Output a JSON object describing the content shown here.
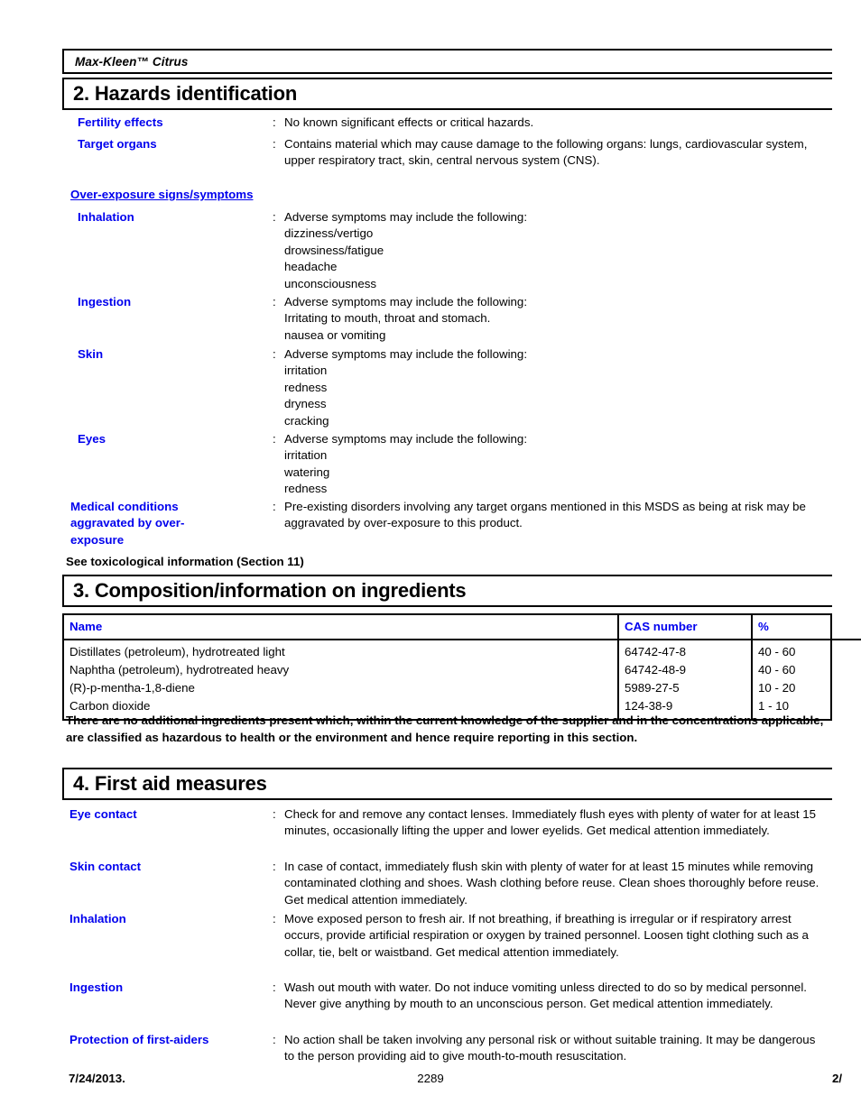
{
  "document": {
    "product_name": "Max-Kleen™ Citrus"
  },
  "section2": {
    "title": "2. Hazards identification",
    "rows": [
      {
        "label": "Fertility effects",
        "colon": ":",
        "value": "No known significant effects or critical hazards."
      },
      {
        "label": "Target organs",
        "colon": ":",
        "value": "Contains material which may cause damage to the following organs: lungs, cardiovascular system, upper respiratory tract, skin, central nervous system (CNS)."
      }
    ],
    "overexposure_heading": "Over-exposure signs/symptoms",
    "overexposure_rows": [
      {
        "label": "Inhalation",
        "colon": ":",
        "lines": [
          "Adverse symptoms may include the following:",
          "dizziness/vertigo",
          "drowsiness/fatigue",
          "headache",
          "unconsciousness"
        ]
      },
      {
        "label": "Ingestion",
        "colon": ":",
        "lines": [
          "Adverse symptoms may include the following:",
          "Irritating to mouth, throat and stomach.",
          "nausea or vomiting"
        ]
      },
      {
        "label": "Skin",
        "colon": ":",
        "lines": [
          "Adverse symptoms may include the following:",
          "irritation",
          "redness",
          "dryness",
          "cracking"
        ]
      },
      {
        "label": "Eyes",
        "colon": ":",
        "lines": [
          "Adverse symptoms may include the following:",
          "irritation",
          "watering",
          "redness"
        ]
      }
    ],
    "medical_conditions": {
      "label_lines": [
        "Medical conditions",
        "aggravated by over-",
        "exposure"
      ],
      "colon": ":",
      "value": "Pre-existing disorders involving any target organs mentioned in this MSDS as being at risk may be aggravated by over-exposure to this product."
    },
    "see_tox_note": "See toxicological information (Section 11)"
  },
  "section3": {
    "title": "3. Composition/information on ingredients",
    "table": {
      "headers": [
        "Name",
        "CAS number",
        "%"
      ],
      "rows": [
        [
          "Distillates (petroleum), hydrotreated light",
          "64742-47-8",
          "40 - 60"
        ],
        [
          "Naphtha (petroleum), hydrotreated heavy",
          "64742-48-9",
          "40 - 60"
        ],
        [
          "(R)-p-mentha-1,8-diene",
          "5989-27-5",
          "10 - 20"
        ],
        [
          "Carbon dioxide",
          "124-38-9",
          "1 - 10"
        ]
      ]
    },
    "note": "There are no additional ingredients present which, within the current knowledge of the supplier and in the concentrations applicable, are classified as hazardous to health or the environment and hence require reporting in this section."
  },
  "section4": {
    "title": "4. First aid measures",
    "rows": [
      {
        "label": "Eye contact",
        "colon": ":",
        "value": "Check for and remove any contact lenses.  Immediately flush eyes with plenty of water for at least 15 minutes, occasionally lifting the upper and lower eyelids.  Get medical attention immediately."
      },
      {
        "label": "Skin contact",
        "colon": ":",
        "value": "In case of contact, immediately flush skin with plenty of water for at least 15 minutes while removing contaminated clothing and shoes.  Wash clothing before reuse.  Clean shoes thoroughly before reuse.  Get medical attention immediately."
      },
      {
        "label": "Inhalation",
        "colon": ":",
        "value": "Move exposed person to fresh air.  If not breathing, if breathing is irregular or if respiratory arrest occurs, provide artificial respiration or oxygen by trained personnel.  Loosen tight clothing such as a collar, tie, belt or waistband.  Get medical attention immediately."
      },
      {
        "label": "Ingestion",
        "colon": ":",
        "value": "Wash out mouth with water.  Do not induce vomiting unless directed to do so by medical personnel.  Never give anything by mouth to an unconscious person.  Get medical attention immediately."
      },
      {
        "label": "Protection of first-aiders",
        "colon": ":",
        "value": "No action shall be taken involving any personal risk or without suitable training.  It may be dangerous to the person providing aid to give mouth-to-mouth resuscitation."
      }
    ]
  },
  "footer": {
    "date": "7/24/2013.",
    "center": "2289",
    "page": "2/"
  },
  "colors": {
    "label_blue": "#0000ee",
    "text_black": "#000000",
    "rule_black": "#000000"
  }
}
